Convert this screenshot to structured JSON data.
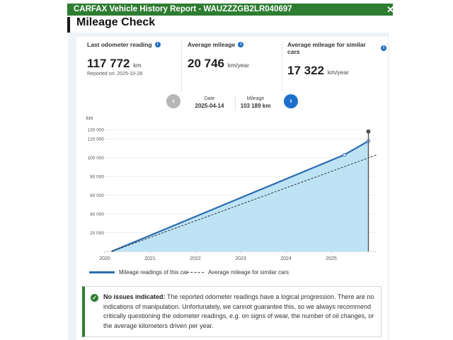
{
  "header": {
    "title": "CARFAX Vehicle History Report - WAUZZZGB2LR040697",
    "close_icon": "close-icon"
  },
  "page": {
    "title": "Mileage Check"
  },
  "stats": [
    {
      "label": "Last odometer reading",
      "value": "117 772",
      "unit": "km",
      "sub": "Reported on: 2025-10-28"
    },
    {
      "label": "Average mileage",
      "value": "20 746",
      "unit": "km/year"
    },
    {
      "label": "Average mileage for similar cars",
      "value": "17 322",
      "unit": "km/year"
    }
  ],
  "reading": {
    "date_label": "Date",
    "date_value": "2025-04-14",
    "mileage_label": "Mileage",
    "mileage_value": "103 189 km"
  },
  "colors": {
    "header_green": "#2e7d32",
    "accent_blue": "#1d6fcc",
    "fill_blue": "#bde3f5",
    "line_blue": "#2b6cb0"
  },
  "chart_data": {
    "type": "area",
    "ylabel": "km",
    "y_ticks": [
      20000,
      40000,
      60000,
      80000,
      100000,
      120000,
      130000
    ],
    "y_tick_labels": [
      "20 000",
      "40 000",
      "60 000",
      "80 000",
      "100 000",
      "120 000",
      "130 000"
    ],
    "ylim": [
      0,
      130000
    ],
    "x_ticks": [
      "2020",
      "2021",
      "2022",
      "2023",
      "2024",
      "2025"
    ],
    "xlim": [
      2020.0,
      2026.0
    ],
    "grid": true,
    "series": [
      {
        "name": "Mileage readings of this car",
        "style": "solid-area",
        "x": [
          2020.15,
          2025.29,
          2025.82
        ],
        "y": [
          0,
          103189,
          117772
        ]
      },
      {
        "name": "Average mileage for similar cars",
        "style": "dashed",
        "x": [
          2020.15,
          2026.0
        ],
        "y": [
          0,
          103000
        ]
      }
    ],
    "legend": "bottom"
  },
  "notice": {
    "title": "No issues indicated:",
    "text": "The reported odometer readings have a logical progression. There are no indications of manipulation. Unfortunately, we cannot guarantee this, so we always recommend critically questioning the odometer readings, e.g. on signs of wear, the number of oil changes, or the average kilometers driven per year."
  }
}
